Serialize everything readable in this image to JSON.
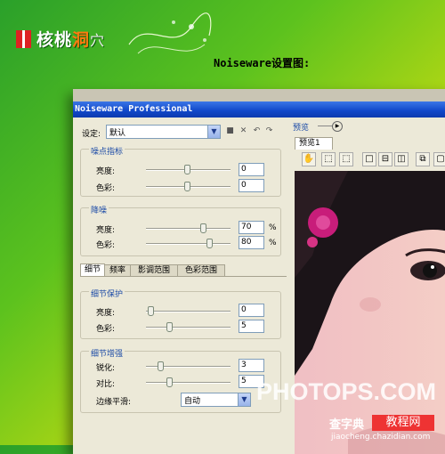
{
  "logo": {
    "text_a": "核桃",
    "text_b": "洞",
    "text_c": "穴"
  },
  "heading": "Noiseware设置图:",
  "window": {
    "title": "Noiseware Professional",
    "settings_label": "设定:",
    "settings_value": "默认"
  },
  "noise_level": {
    "title": "噪点指标",
    "luminance_label": "亮度:",
    "luminance_value": "0",
    "luminance_fraction": 0.48,
    "color_label": "色彩:",
    "color_value": "0",
    "color_fraction": 0.48
  },
  "noise_reduction": {
    "title": "降噪",
    "luminance_label": "亮度:",
    "luminance_value": "70",
    "luminance_fraction": 0.68,
    "color_label": "色彩:",
    "color_value": "80",
    "color_fraction": 0.76,
    "percent": "%"
  },
  "tabs": [
    "细节",
    "频率",
    "影调范围",
    "色彩范围"
  ],
  "detail_protection": {
    "title": "细节保护",
    "luminance_label": "亮度:",
    "luminance_value": "0",
    "luminance_fraction": 0.02,
    "color_label": "色彩:",
    "color_value": "5",
    "color_fraction": 0.26
  },
  "detail_enhancement": {
    "title": "细节增强",
    "sharpen_label": "锐化:",
    "sharpen_value": "3",
    "sharpen_fraction": 0.15,
    "contrast_label": "对比:",
    "contrast_value": "5",
    "contrast_fraction": 0.26,
    "edge_label": "边缘平滑:",
    "edge_value": "自动"
  },
  "preview": {
    "title": "预览",
    "tab": "预览1"
  },
  "watermark": {
    "brand": "PHOTOPS.COM",
    "site_a": "查字典",
    "site_b": "教程网",
    "url": "jiaocheng.chazidian.com"
  }
}
